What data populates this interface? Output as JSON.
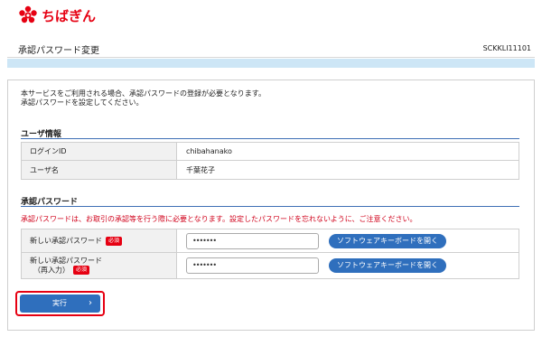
{
  "header": {
    "logo_text": "ちばぎん"
  },
  "titlebar": {
    "title": "承認パスワード変更",
    "screen_id": "SCKKLI11101"
  },
  "intro": [
    "本サービスをご利用される場合、承認パスワードの登録が必要となります。",
    "承認パスワードを設定してください。"
  ],
  "user_info": {
    "title": "ユーザ情報",
    "rows": [
      {
        "label": "ログインID",
        "value": "chibahanako"
      },
      {
        "label": "ユーザ名",
        "value": "千葉花子"
      }
    ]
  },
  "password": {
    "title": "承認パスワード",
    "warning": "承認パスワードは、お取引の承認等を行う際に必要となります。設定したパスワードを忘れないように、ご注意ください。",
    "rows": [
      {
        "label_line1": "新しい承認パスワード",
        "label_line2": "",
        "required_badge": "必須",
        "value": "•••••••",
        "keyboard_button": "ソフトウェアキーボードを開く"
      },
      {
        "label_line1": "新しい承認パスワード",
        "label_line2": "（再入力）",
        "required_badge": "必須",
        "value": "•••••••",
        "keyboard_button": "ソフトウェアキーボードを開く"
      }
    ]
  },
  "actions": {
    "execute_label": "実行",
    "execute_icon": "chevron-right-icon"
  },
  "colors": {
    "brand_red": "#e60012",
    "button_blue": "#2f6fbd",
    "strip_blue": "#cde6f6",
    "warning_red": "#d0021b"
  }
}
